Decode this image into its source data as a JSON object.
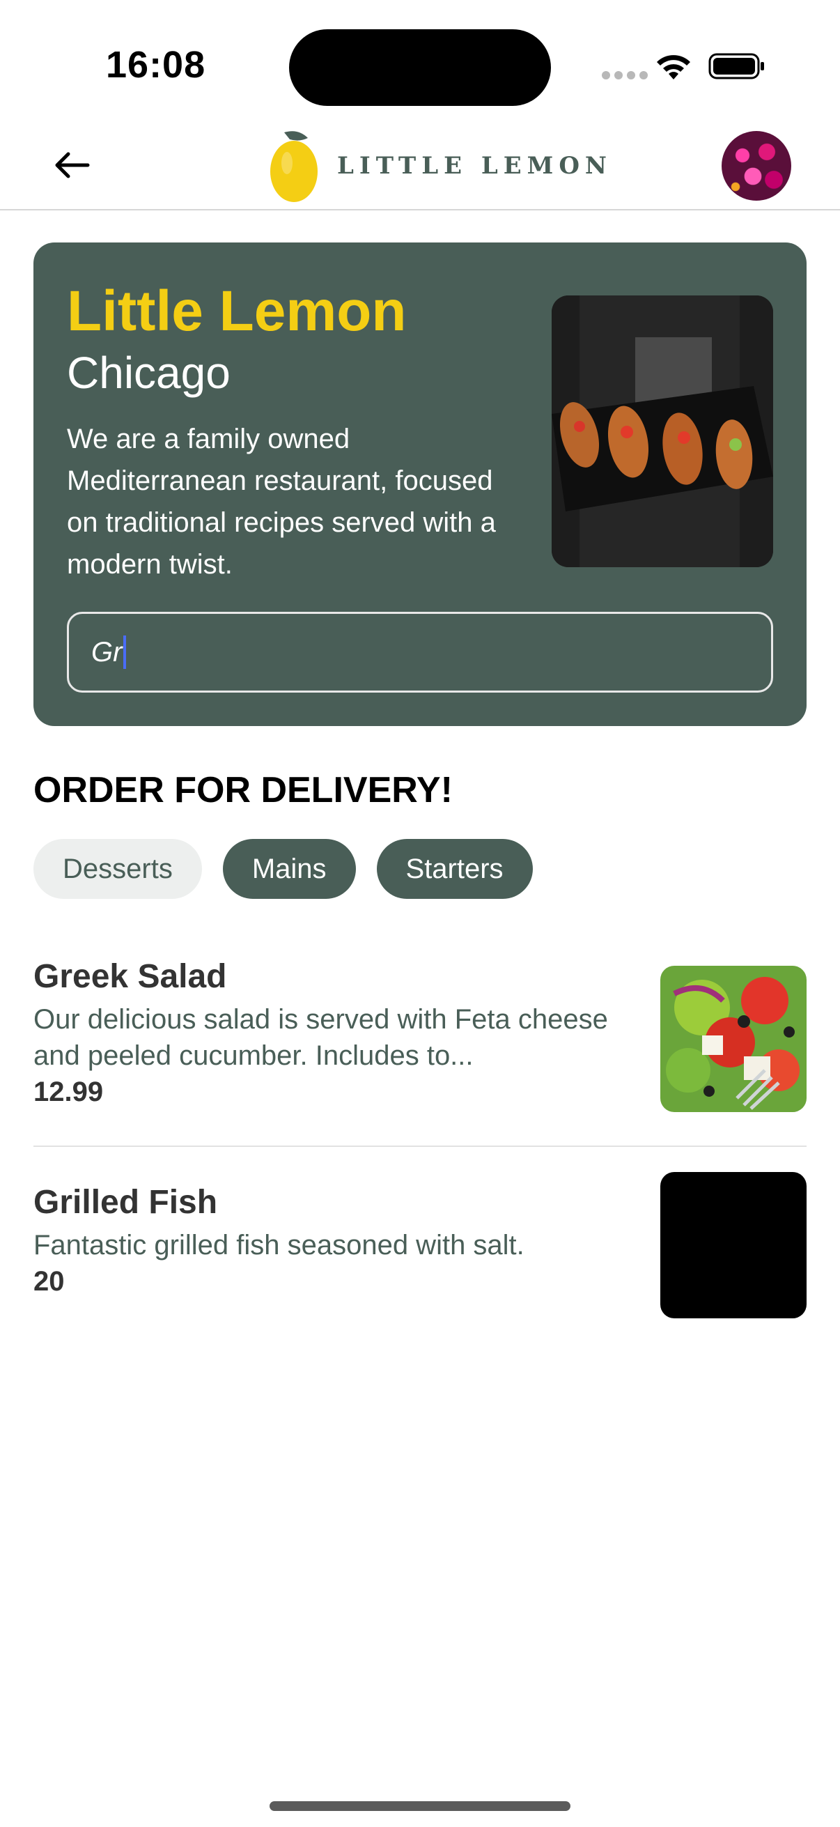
{
  "status_bar": {
    "time": "16:08"
  },
  "header": {
    "logo_text": "LITTLE LEMON"
  },
  "hero": {
    "title": "Little Lemon",
    "city": "Chicago",
    "description": "We are a family owned Mediterranean restaurant, focused on traditional recipes served with a modern twist.",
    "search_value": "Gr"
  },
  "order": {
    "title": "ORDER FOR DELIVERY!",
    "categories": [
      {
        "label": "Desserts",
        "selected": false
      },
      {
        "label": "Mains",
        "selected": true
      },
      {
        "label": "Starters",
        "selected": true
      }
    ]
  },
  "menu": [
    {
      "name": "Greek Salad",
      "description": "Our delicious salad is served with Feta cheese and peeled cucumber. Includes to...",
      "price": "12.99"
    },
    {
      "name": "Grilled Fish",
      "description": "Fantastic grilled fish seasoned with salt.",
      "price": "20"
    }
  ],
  "colors": {
    "primary_green": "#495e57",
    "accent_yellow": "#f4ce14",
    "chip_light": "#edefee"
  }
}
